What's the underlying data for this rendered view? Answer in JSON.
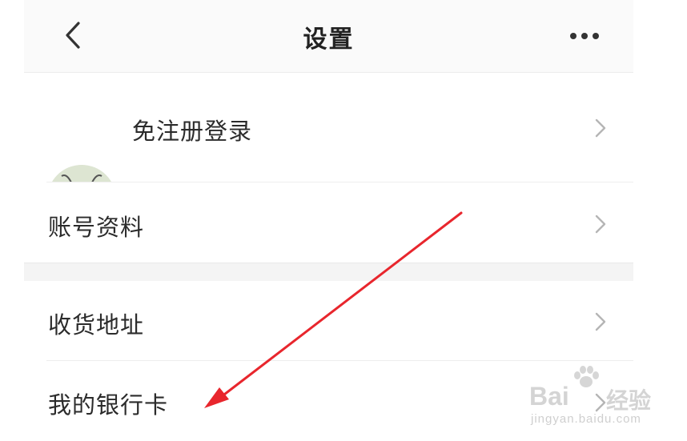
{
  "header": {
    "title": "设置",
    "back_icon": "chevron-left-icon",
    "more_icon": "more-horizontal-icon"
  },
  "profile": {
    "label": "免注册登录",
    "avatar_icon": "cartoon-ant-avatar"
  },
  "rows": [
    {
      "label": "账号资料"
    },
    {
      "label": "收货地址"
    },
    {
      "label": "我的银行卡"
    }
  ],
  "annotation": {
    "color": "#e8262d",
    "icon": "red-arrow-annotation"
  },
  "watermark": {
    "brand": "Bai",
    "brand_suffix": "经验",
    "url": "jingyan.baidu.com"
  }
}
